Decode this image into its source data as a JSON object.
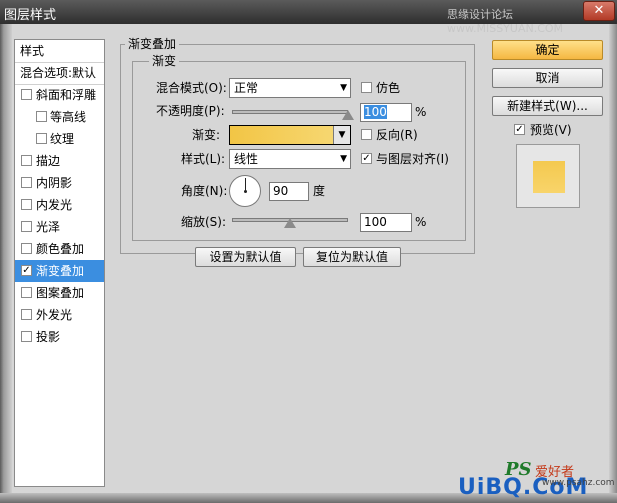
{
  "window": {
    "title": "图层样式",
    "watermark": "思缘设计论坛 www.MISSYUAN.COM",
    "close_glyph": "✕"
  },
  "style_list": {
    "header": "样式",
    "blend_options": "混合选项:默认",
    "items": [
      {
        "label": "斜面和浮雕",
        "checked": false
      },
      {
        "label": "等高线",
        "checked": false,
        "sub": true
      },
      {
        "label": "纹理",
        "checked": false,
        "sub": true
      },
      {
        "label": "描边",
        "checked": false
      },
      {
        "label": "内阴影",
        "checked": false
      },
      {
        "label": "内发光",
        "checked": false
      },
      {
        "label": "光泽",
        "checked": false
      },
      {
        "label": "颜色叠加",
        "checked": false
      },
      {
        "label": "渐变叠加",
        "checked": true,
        "selected": true
      },
      {
        "label": "图案叠加",
        "checked": false
      },
      {
        "label": "外发光",
        "checked": false
      },
      {
        "label": "投影",
        "checked": false
      }
    ]
  },
  "panel": {
    "title": "渐变叠加",
    "group": "渐变",
    "blend_mode_label": "混合模式(O):",
    "blend_mode_value": "正常",
    "dither_label": "仿色",
    "opacity_label": "不透明度(P):",
    "opacity_value": "100",
    "opacity_unit": "%",
    "opacity_fraction": 1.0,
    "gradient_label": "渐变:",
    "reverse_label": "反向(R)",
    "style_label": "样式(L):",
    "style_value": "线性",
    "align_label": "与图层对齐(I)",
    "align_checked": true,
    "angle_label": "角度(N):",
    "angle_value": "90",
    "angle_unit": "度",
    "scale_label": "缩放(S):",
    "scale_value": "100",
    "scale_unit": "%",
    "scale_fraction": 0.5,
    "set_default": "设置为默认值",
    "reset_default": "复位为默认值",
    "gradient_colors": [
      "#f2c545",
      "#f7da78"
    ]
  },
  "actions": {
    "ok": "确定",
    "cancel": "取消",
    "new_style": "新建样式(W)...",
    "preview_label": "预览(V)",
    "preview_checked": true,
    "preview_color": "#f6cf5c"
  },
  "logos": {
    "ps": "PS",
    "ps_cn": "爱好者",
    "url": "www.psahz.com",
    "ubq": "UiBQ.CoM"
  }
}
